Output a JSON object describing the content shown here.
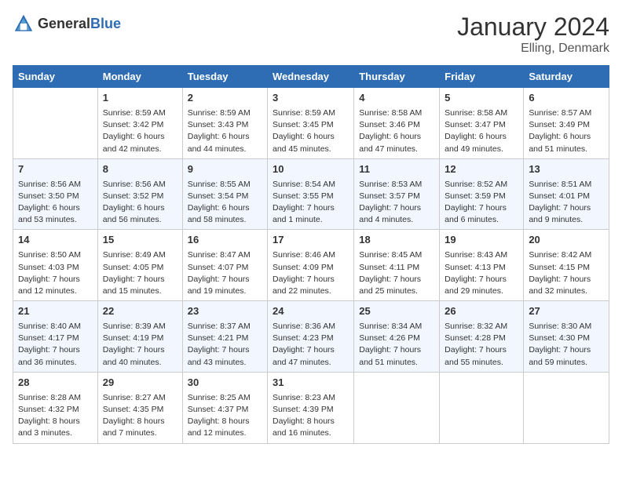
{
  "header": {
    "logo_general": "General",
    "logo_blue": "Blue",
    "month_year": "January 2024",
    "location": "Elling, Denmark"
  },
  "days_of_week": [
    "Sunday",
    "Monday",
    "Tuesday",
    "Wednesday",
    "Thursday",
    "Friday",
    "Saturday"
  ],
  "weeks": [
    [
      {
        "day": "",
        "sunrise": "",
        "sunset": "",
        "daylight": ""
      },
      {
        "day": "1",
        "sunrise": "Sunrise: 8:59 AM",
        "sunset": "Sunset: 3:42 PM",
        "daylight": "Daylight: 6 hours and 42 minutes."
      },
      {
        "day": "2",
        "sunrise": "Sunrise: 8:59 AM",
        "sunset": "Sunset: 3:43 PM",
        "daylight": "Daylight: 6 hours and 44 minutes."
      },
      {
        "day": "3",
        "sunrise": "Sunrise: 8:59 AM",
        "sunset": "Sunset: 3:45 PM",
        "daylight": "Daylight: 6 hours and 45 minutes."
      },
      {
        "day": "4",
        "sunrise": "Sunrise: 8:58 AM",
        "sunset": "Sunset: 3:46 PM",
        "daylight": "Daylight: 6 hours and 47 minutes."
      },
      {
        "day": "5",
        "sunrise": "Sunrise: 8:58 AM",
        "sunset": "Sunset: 3:47 PM",
        "daylight": "Daylight: 6 hours and 49 minutes."
      },
      {
        "day": "6",
        "sunrise": "Sunrise: 8:57 AM",
        "sunset": "Sunset: 3:49 PM",
        "daylight": "Daylight: 6 hours and 51 minutes."
      }
    ],
    [
      {
        "day": "7",
        "sunrise": "Sunrise: 8:56 AM",
        "sunset": "Sunset: 3:50 PM",
        "daylight": "Daylight: 6 hours and 53 minutes."
      },
      {
        "day": "8",
        "sunrise": "Sunrise: 8:56 AM",
        "sunset": "Sunset: 3:52 PM",
        "daylight": "Daylight: 6 hours and 56 minutes."
      },
      {
        "day": "9",
        "sunrise": "Sunrise: 8:55 AM",
        "sunset": "Sunset: 3:54 PM",
        "daylight": "Daylight: 6 hours and 58 minutes."
      },
      {
        "day": "10",
        "sunrise": "Sunrise: 8:54 AM",
        "sunset": "Sunset: 3:55 PM",
        "daylight": "Daylight: 7 hours and 1 minute."
      },
      {
        "day": "11",
        "sunrise": "Sunrise: 8:53 AM",
        "sunset": "Sunset: 3:57 PM",
        "daylight": "Daylight: 7 hours and 4 minutes."
      },
      {
        "day": "12",
        "sunrise": "Sunrise: 8:52 AM",
        "sunset": "Sunset: 3:59 PM",
        "daylight": "Daylight: 7 hours and 6 minutes."
      },
      {
        "day": "13",
        "sunrise": "Sunrise: 8:51 AM",
        "sunset": "Sunset: 4:01 PM",
        "daylight": "Daylight: 7 hours and 9 minutes."
      }
    ],
    [
      {
        "day": "14",
        "sunrise": "Sunrise: 8:50 AM",
        "sunset": "Sunset: 4:03 PM",
        "daylight": "Daylight: 7 hours and 12 minutes."
      },
      {
        "day": "15",
        "sunrise": "Sunrise: 8:49 AM",
        "sunset": "Sunset: 4:05 PM",
        "daylight": "Daylight: 7 hours and 15 minutes."
      },
      {
        "day": "16",
        "sunrise": "Sunrise: 8:47 AM",
        "sunset": "Sunset: 4:07 PM",
        "daylight": "Daylight: 7 hours and 19 minutes."
      },
      {
        "day": "17",
        "sunrise": "Sunrise: 8:46 AM",
        "sunset": "Sunset: 4:09 PM",
        "daylight": "Daylight: 7 hours and 22 minutes."
      },
      {
        "day": "18",
        "sunrise": "Sunrise: 8:45 AM",
        "sunset": "Sunset: 4:11 PM",
        "daylight": "Daylight: 7 hours and 25 minutes."
      },
      {
        "day": "19",
        "sunrise": "Sunrise: 8:43 AM",
        "sunset": "Sunset: 4:13 PM",
        "daylight": "Daylight: 7 hours and 29 minutes."
      },
      {
        "day": "20",
        "sunrise": "Sunrise: 8:42 AM",
        "sunset": "Sunset: 4:15 PM",
        "daylight": "Daylight: 7 hours and 32 minutes."
      }
    ],
    [
      {
        "day": "21",
        "sunrise": "Sunrise: 8:40 AM",
        "sunset": "Sunset: 4:17 PM",
        "daylight": "Daylight: 7 hours and 36 minutes."
      },
      {
        "day": "22",
        "sunrise": "Sunrise: 8:39 AM",
        "sunset": "Sunset: 4:19 PM",
        "daylight": "Daylight: 7 hours and 40 minutes."
      },
      {
        "day": "23",
        "sunrise": "Sunrise: 8:37 AM",
        "sunset": "Sunset: 4:21 PM",
        "daylight": "Daylight: 7 hours and 43 minutes."
      },
      {
        "day": "24",
        "sunrise": "Sunrise: 8:36 AM",
        "sunset": "Sunset: 4:23 PM",
        "daylight": "Daylight: 7 hours and 47 minutes."
      },
      {
        "day": "25",
        "sunrise": "Sunrise: 8:34 AM",
        "sunset": "Sunset: 4:26 PM",
        "daylight": "Daylight: 7 hours and 51 minutes."
      },
      {
        "day": "26",
        "sunrise": "Sunrise: 8:32 AM",
        "sunset": "Sunset: 4:28 PM",
        "daylight": "Daylight: 7 hours and 55 minutes."
      },
      {
        "day": "27",
        "sunrise": "Sunrise: 8:30 AM",
        "sunset": "Sunset: 4:30 PM",
        "daylight": "Daylight: 7 hours and 59 minutes."
      }
    ],
    [
      {
        "day": "28",
        "sunrise": "Sunrise: 8:28 AM",
        "sunset": "Sunset: 4:32 PM",
        "daylight": "Daylight: 8 hours and 3 minutes."
      },
      {
        "day": "29",
        "sunrise": "Sunrise: 8:27 AM",
        "sunset": "Sunset: 4:35 PM",
        "daylight": "Daylight: 8 hours and 7 minutes."
      },
      {
        "day": "30",
        "sunrise": "Sunrise: 8:25 AM",
        "sunset": "Sunset: 4:37 PM",
        "daylight": "Daylight: 8 hours and 12 minutes."
      },
      {
        "day": "31",
        "sunrise": "Sunrise: 8:23 AM",
        "sunset": "Sunset: 4:39 PM",
        "daylight": "Daylight: 8 hours and 16 minutes."
      },
      {
        "day": "",
        "sunrise": "",
        "sunset": "",
        "daylight": ""
      },
      {
        "day": "",
        "sunrise": "",
        "sunset": "",
        "daylight": ""
      },
      {
        "day": "",
        "sunrise": "",
        "sunset": "",
        "daylight": ""
      }
    ]
  ]
}
